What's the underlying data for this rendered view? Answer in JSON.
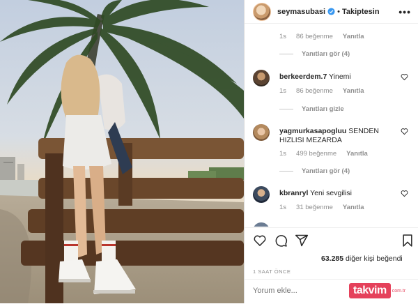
{
  "header": {
    "username": "seymasubasi",
    "separator": "•",
    "follow_state": "Takiptesin",
    "more_icon": "more-horizontal-icon"
  },
  "comments": {
    "top_meta": {
      "time": "1s",
      "likes": "86 beğenme",
      "reply": "Yanıtla"
    },
    "top_replies": "Yanıtları gör (4)",
    "items": [
      {
        "username": "berkeerdem.7",
        "text": "Yinemi",
        "time": "1s",
        "likes": "86 beğenme",
        "reply": "Yanıtla",
        "replies": "Yanıtları gizle"
      },
      {
        "username": "yagmurkasapogluu",
        "text": "SENDEN HIZLISI MEZARDA",
        "time": "1s",
        "likes": "499 beğenme",
        "reply": "Yanıtla",
        "replies": "Yanıtları gör (4)"
      },
      {
        "username": "kbranryl",
        "text": "Yeni sevgilisi",
        "time": "1s",
        "likes": "31 beğenme",
        "reply": "Yanıtla"
      }
    ]
  },
  "actions": {
    "like_icon": "heart-icon",
    "comment_icon": "comment-icon",
    "share_icon": "share-icon",
    "save_icon": "bookmark-icon"
  },
  "likes": {
    "count": "63.285",
    "text": "diğer kişi beğendi"
  },
  "time_ago": "1 SAAT ÖNCE",
  "add_comment": {
    "placeholder": "Yorum ekle..."
  },
  "watermark": {
    "brand": "takvim",
    "suffix": "com.tr"
  },
  "colors": {
    "accent": "#0095f6",
    "watermark": "#e1203f",
    "muted": "#8e8e8e"
  }
}
